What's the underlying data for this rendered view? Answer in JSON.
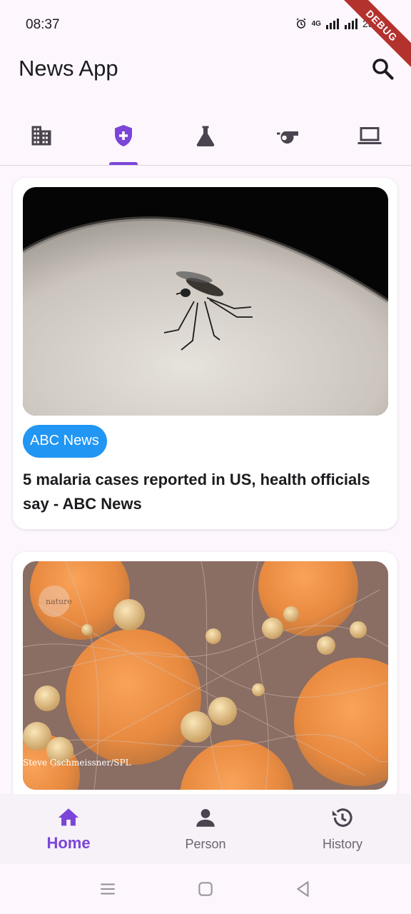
{
  "status_bar": {
    "time": "08:37",
    "network": "4G",
    "battery": "25%",
    "debug_label": "DEBUG"
  },
  "app": {
    "title": "News App"
  },
  "tabs": [
    {
      "icon": "building-icon",
      "label": "Business"
    },
    {
      "icon": "health-shield-icon",
      "label": "Health",
      "selected": true
    },
    {
      "icon": "flask-icon",
      "label": "Science"
    },
    {
      "icon": "whistle-icon",
      "label": "Sports"
    },
    {
      "icon": "laptop-icon",
      "label": "Technology"
    }
  ],
  "articles": [
    {
      "source": "ABC News",
      "title": "5 malaria cases reported in US, health officials say - ABC News",
      "image": "mosquito-on-skin"
    },
    {
      "source": "",
      "title": "",
      "image": "fat-cells-micrograph",
      "credit": "Steve Gschmeissner/SPL",
      "watermark": "nature"
    }
  ],
  "bottom_nav": [
    {
      "label": "Home",
      "icon": "home-icon",
      "active": true
    },
    {
      "label": "Person",
      "icon": "person-icon",
      "active": false
    },
    {
      "label": "History",
      "icon": "history-icon",
      "active": false
    }
  ],
  "colors": {
    "accent": "#7b45d9",
    "chip": "#2196f3",
    "icon": "#4a4450",
    "text": "#1c1b1f"
  }
}
